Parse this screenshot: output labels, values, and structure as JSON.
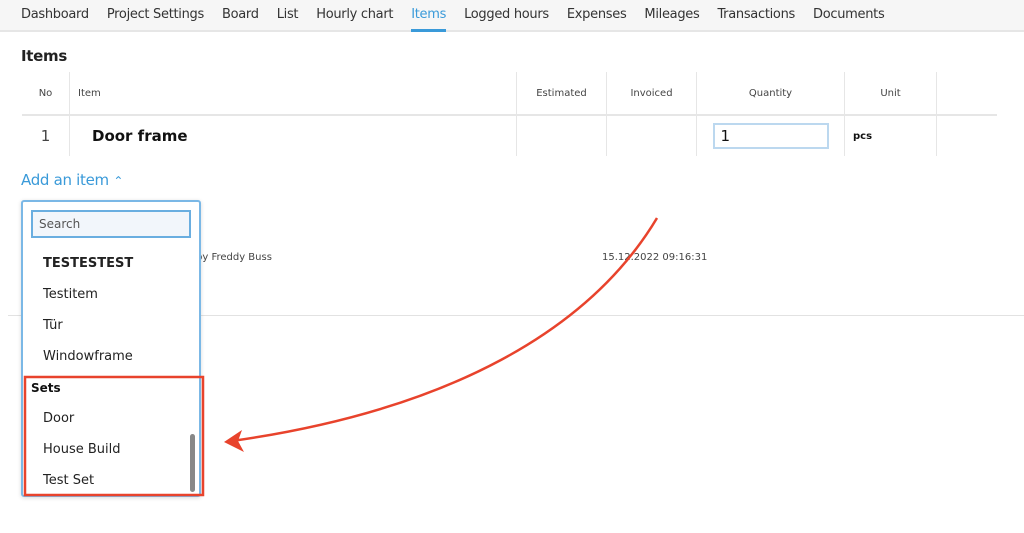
{
  "nav": {
    "tabs": [
      "Dashboard",
      "Project Settings",
      "Board",
      "List",
      "Hourly chart",
      "Items",
      "Logged hours",
      "Expenses",
      "Mileages",
      "Transactions",
      "Documents"
    ],
    "active": "Items"
  },
  "section_title": "Items",
  "table": {
    "headers": [
      "No",
      "Item",
      "Estimated",
      "Invoiced",
      "Quantity",
      "Unit"
    ],
    "rows": [
      {
        "no": "1",
        "item": "Door frame",
        "estimated": "",
        "invoiced": "",
        "quantity": "1",
        "unit": "pcs"
      }
    ]
  },
  "add_item": {
    "label": "Add an item",
    "icon": "chevron-up-icon"
  },
  "background": {
    "author": "by Freddy Buss",
    "datetime": "15.12.2022 09:16:31"
  },
  "dropdown": {
    "search_placeholder": "Search",
    "items": [
      "TESTESTEST",
      "Testitem",
      "Tür",
      "Windowframe"
    ],
    "group_label": "Sets",
    "sets": [
      "Door",
      "House Build",
      "Test Set"
    ]
  },
  "colors": {
    "accent": "#3a9ad9",
    "annotation": "#e8432c"
  }
}
